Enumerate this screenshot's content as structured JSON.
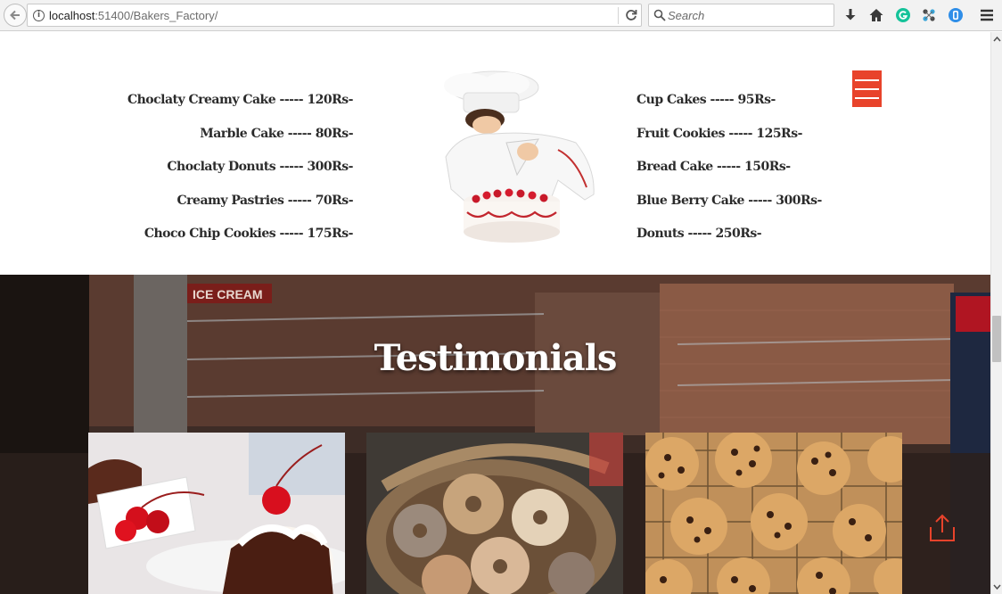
{
  "browser": {
    "url_host": "localhost",
    "url_rest": ":51400/Bakers_Factory/",
    "search_placeholder": "Search",
    "icons": [
      "back-arrow-icon",
      "info-icon",
      "reload-icon",
      "search-icon",
      "download-icon",
      "home-icon",
      "grammarly-icon",
      "extension-icon",
      "shield-icon",
      "hamburger-menu-icon"
    ]
  },
  "menu": {
    "left_items": [
      "Choclaty Creamy Cake ----- 120Rs-",
      "Marble Cake ----- 80Rs-",
      "Choclaty Donuts ----- 300Rs-",
      "Creamy Pastries ----- 70Rs-",
      "Choco Chip Cookies ----- 175Rs-"
    ],
    "right_items": [
      "Cup Cakes ----- 95Rs-",
      "Fruit Cookies ----- 125Rs-",
      "Bread Cake ----- 150Rs-",
      "Blue Berry Cake ----- 300Rs-",
      "Donuts ----- 250Rs-"
    ]
  },
  "testimonials": {
    "title": "Testimonials",
    "cards": [
      "cherry-sundae-image",
      "bagels-basket-image",
      "choco-chip-cookies-image"
    ]
  },
  "colors": {
    "accent": "#e8432b",
    "text": "#2b2b2b"
  }
}
